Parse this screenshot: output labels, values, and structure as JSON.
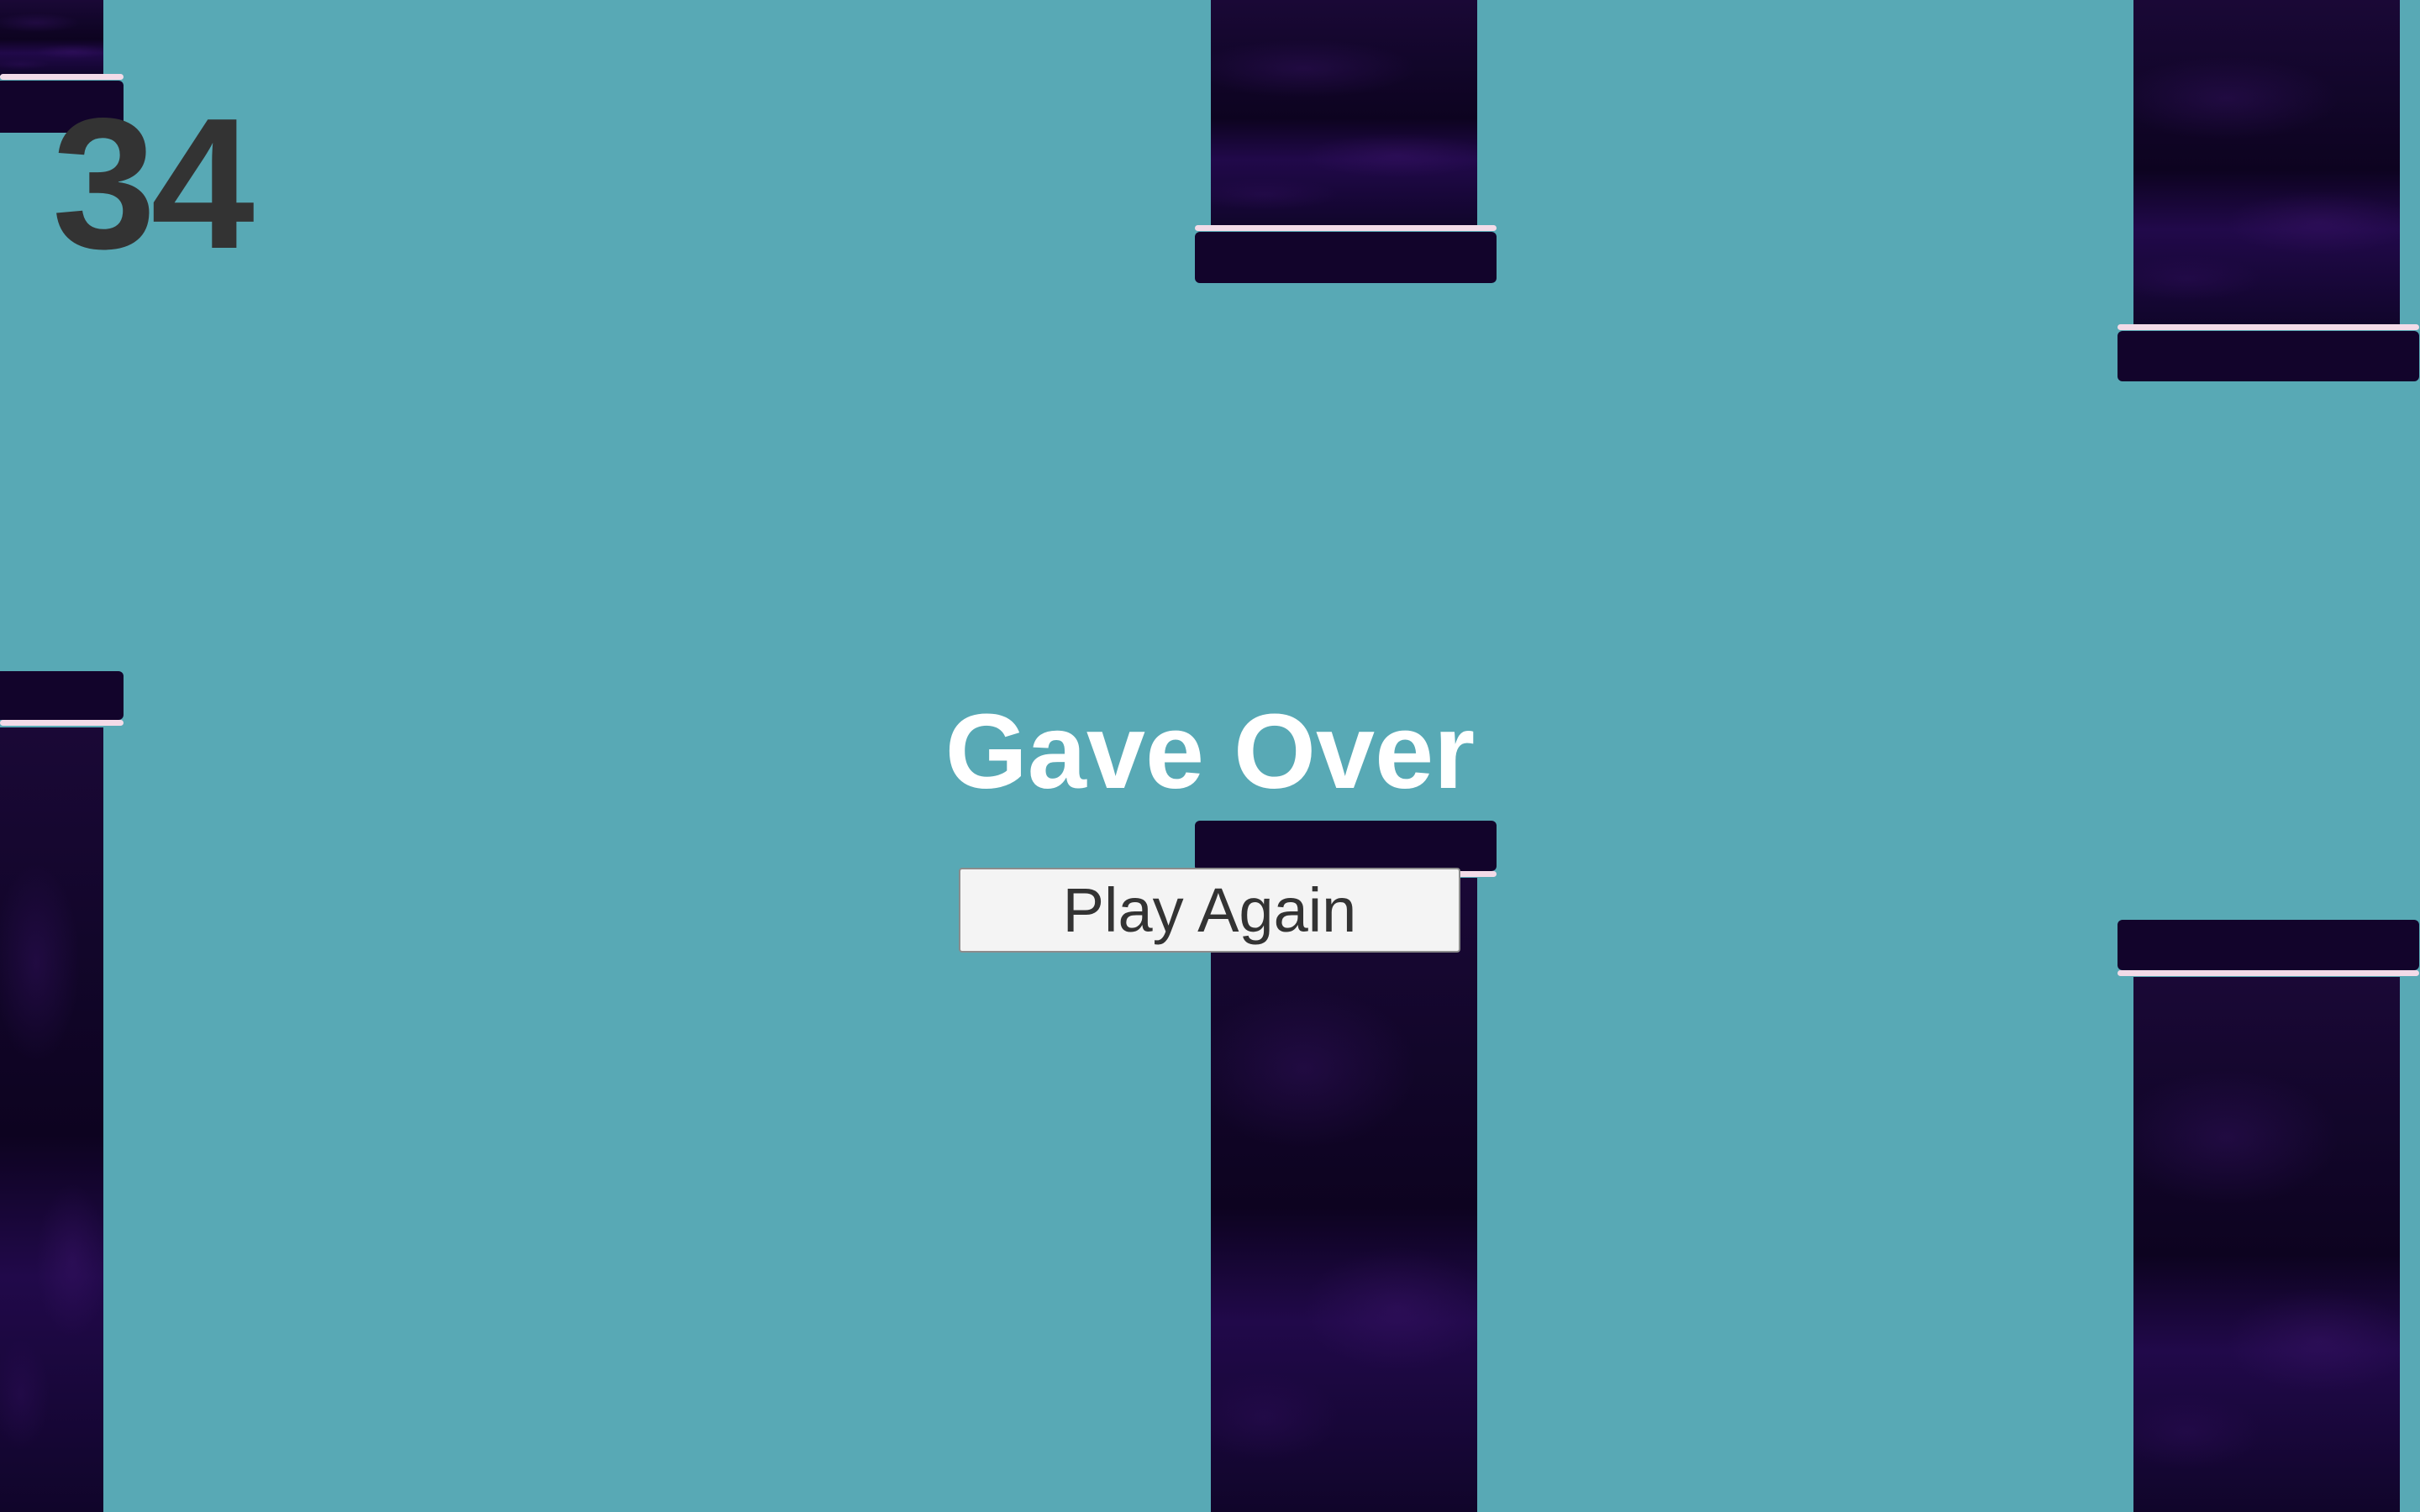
{
  "game": {
    "score": "34",
    "status_title": "Gave Over",
    "play_again_label": "Play Again"
  },
  "colors": {
    "sky": "#58a9b5",
    "pipe_body": "#12062a",
    "pipe_cap": "#12042b",
    "pipe_lip": "#f3dbe8",
    "score_text": "#333333",
    "title_text": "#ffffff",
    "button_bg": "#f4f4f4"
  }
}
